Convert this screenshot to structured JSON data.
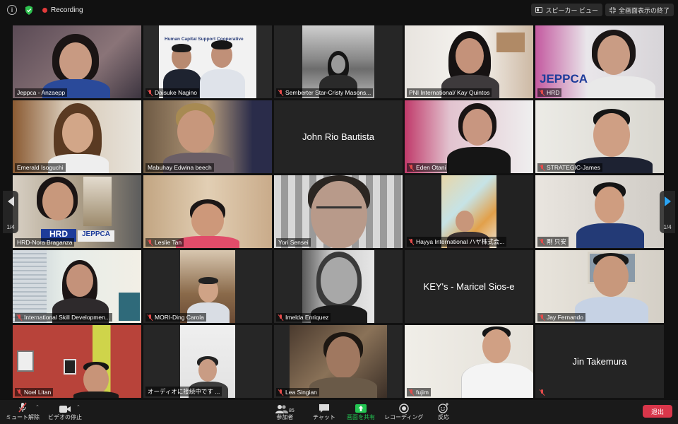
{
  "topbar": {
    "recording_label": "Recording",
    "speaker_view_label": "スピーカー ビュー",
    "exit_fullscreen_label": "全画面表示の終了"
  },
  "nav": {
    "left_page": "1/4",
    "right_page": "1/4"
  },
  "participants": [
    {
      "name": "Jeppca - Anzaepp",
      "display": "",
      "muted": false
    },
    {
      "name": "Daisuke Nagino",
      "display": "",
      "muted": true,
      "sign_text": "Human Capital Support Cooperative"
    },
    {
      "name": "Semberter Star-Cristy Masons...",
      "display": "",
      "muted": true
    },
    {
      "name": "PNI International/ Kay Quintos",
      "display": "",
      "muted": false,
      "active": true
    },
    {
      "name": "HRD",
      "display": "",
      "muted": true,
      "sign_text": "JEPPCA"
    },
    {
      "name": "Emerald Isoguchi",
      "display": "",
      "muted": false
    },
    {
      "name": "Mabuhay Edwina beech",
      "display": "",
      "muted": false
    },
    {
      "name": "",
      "display": "John Rio Bautista",
      "muted": false
    },
    {
      "name": "Eden Otani",
      "display": "",
      "muted": true
    },
    {
      "name": "STRATEGIC-James",
      "display": "",
      "muted": true
    },
    {
      "name": "HRD-Nora Braganza",
      "display": "",
      "muted": false,
      "sign_text": "JEPPCA",
      "sign_text_2": "HRD"
    },
    {
      "name": "Leslie Tan",
      "display": "",
      "muted": true
    },
    {
      "name": "Yori Sensei",
      "display": "",
      "muted": false
    },
    {
      "name": "Hayya International ハヤ株式会...",
      "display": "",
      "muted": true
    },
    {
      "name": "剛 只安",
      "display": "",
      "muted": true
    },
    {
      "name": "International Skill Developmen...",
      "display": "",
      "muted": true
    },
    {
      "name": "MORI-Ding Carola",
      "display": "",
      "muted": true
    },
    {
      "name": "Imelda Enriquez",
      "display": "",
      "muted": true
    },
    {
      "name": "",
      "display": "KEY's - Maricel Sios-e",
      "muted": false
    },
    {
      "name": "Jay Fernando",
      "display": "",
      "muted": true
    },
    {
      "name": "Noel Litan",
      "display": "",
      "muted": true
    },
    {
      "name": "オーディオに接続中です ...",
      "display": "",
      "muted": false
    },
    {
      "name": "Lea Singian",
      "display": "",
      "muted": true
    },
    {
      "name": "fujim",
      "display": "",
      "muted": true
    },
    {
      "name": "",
      "display": "Jin Takemura",
      "muted": true
    }
  ],
  "toolbar": {
    "mute_label": "ミュート解除",
    "video_label": "ビデオの停止",
    "participants_label": "参加者",
    "participants_count": "85",
    "chat_label": "チャット",
    "share_label": "画面を共有",
    "record_label": "レコーディング",
    "reactions_label": "反応",
    "leave_label": "退出"
  },
  "colors": {
    "active_speaker": "#c6d84a",
    "share_green": "#23c552",
    "leave_red": "#d9364a",
    "muted_red": "#e54b4b"
  }
}
